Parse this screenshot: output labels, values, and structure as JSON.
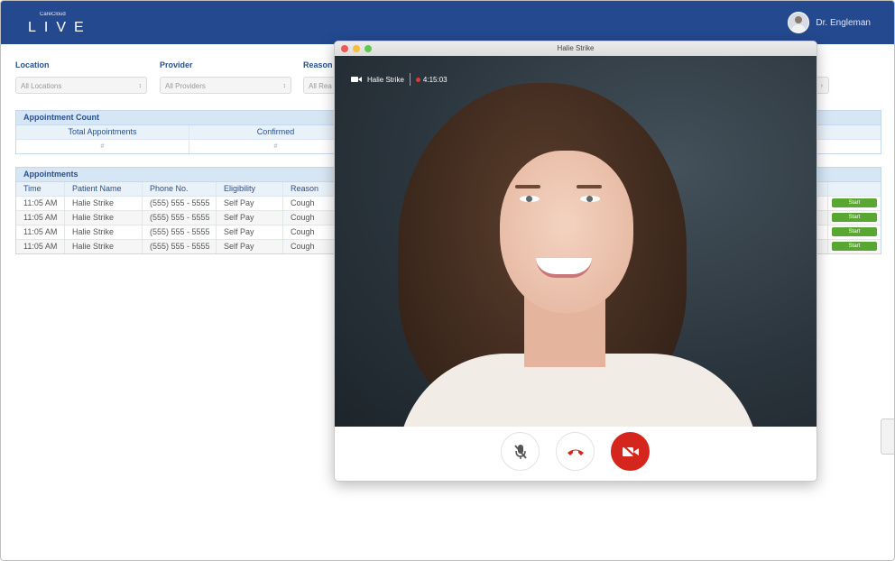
{
  "brand": {
    "small": "CareCloud",
    "name": "LIVE"
  },
  "user": {
    "name": "Dr. Engleman"
  },
  "filters": {
    "location": {
      "label": "Location",
      "value": "All Locations"
    },
    "provider": {
      "label": "Provider",
      "value": "All Providers"
    },
    "reason": {
      "label": "Reason",
      "value": "All Rea"
    }
  },
  "appointment_count": {
    "title": "Appointment Count",
    "headers": [
      "Total Appointments",
      "Confirmed"
    ],
    "values": [
      "#",
      "#"
    ]
  },
  "appointments": {
    "title": "Appointments",
    "headers": [
      "Time",
      "Patient Name",
      "Phone No.",
      "Eligibility",
      "Reason"
    ],
    "rows": [
      [
        "11:05 AM",
        "Halie Strike",
        "(555) 555 - 5555",
        "Self Pay",
        "Cough"
      ],
      [
        "11:05 AM",
        "Halie Strike",
        "(555) 555 - 5555",
        "Self Pay",
        "Cough"
      ],
      [
        "11:05 AM",
        "Halie Strike",
        "(555) 555 - 5555",
        "Self Pay",
        "Cough"
      ],
      [
        "11:05 AM",
        "Halie Strike",
        "(555) 555 - 5555",
        "Self Pay",
        "Cough"
      ]
    ],
    "start_label": "Start"
  },
  "video": {
    "window_title": "Halie Strike",
    "caller": "Halie Strike",
    "duration": "4:15:03"
  },
  "colors": {
    "header": "#24498f",
    "start": "#5aa632",
    "end_call": "#d4261d"
  }
}
